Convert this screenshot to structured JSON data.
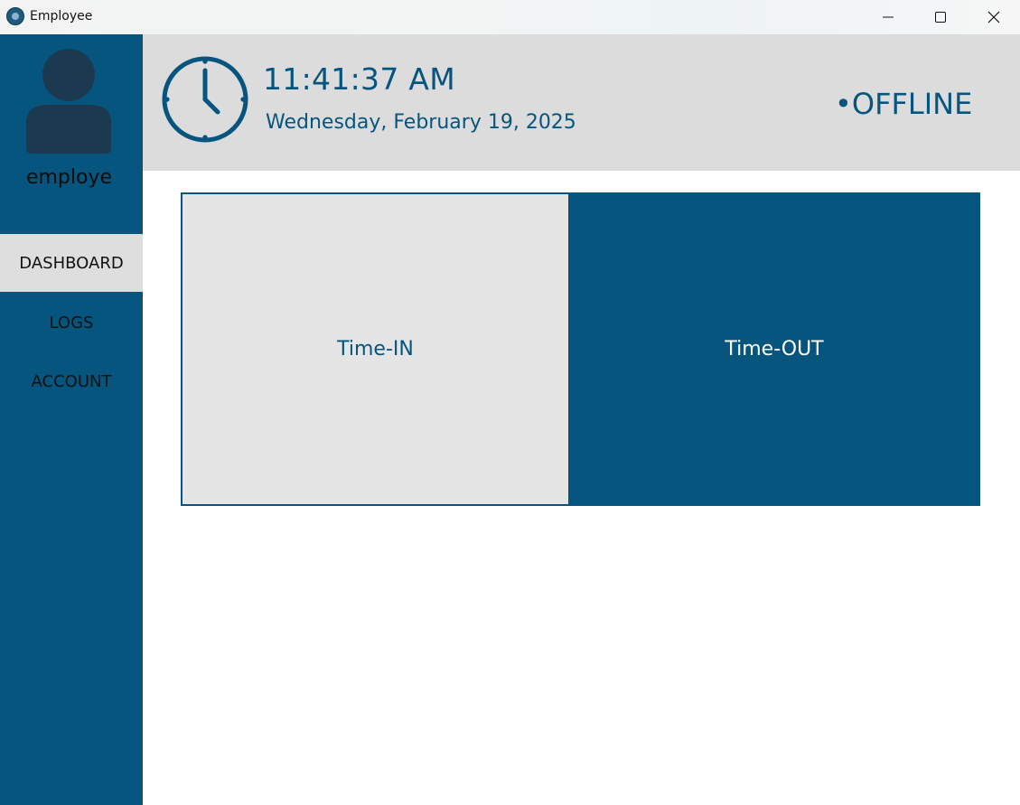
{
  "window": {
    "title": "Employee",
    "icons": {
      "app": "app-logo-icon",
      "minimize": "minimize-icon",
      "maximize": "maximize-icon",
      "close": "close-icon"
    }
  },
  "sidebar": {
    "username": "employe",
    "avatar_icon": "user-avatar-icon",
    "items": [
      {
        "label": "DASHBOARD",
        "active": true
      },
      {
        "label": "LOGS",
        "active": false
      },
      {
        "label": "ACCOUNT",
        "active": false
      }
    ]
  },
  "header": {
    "clock_icon": "clock-icon",
    "time": "11:41:37 AM",
    "date": "Wednesday, February 19, 2025",
    "status": "•OFFLINE"
  },
  "main": {
    "time_in_label": "Time-IN",
    "time_out_label": "Time-OUT"
  },
  "colors": {
    "primary": "#06557e",
    "header_bg": "#dcdcdc",
    "active_nav_bg": "#dedede",
    "time_in_bg": "#e5e5e5",
    "avatar": "#1b3a4f"
  }
}
